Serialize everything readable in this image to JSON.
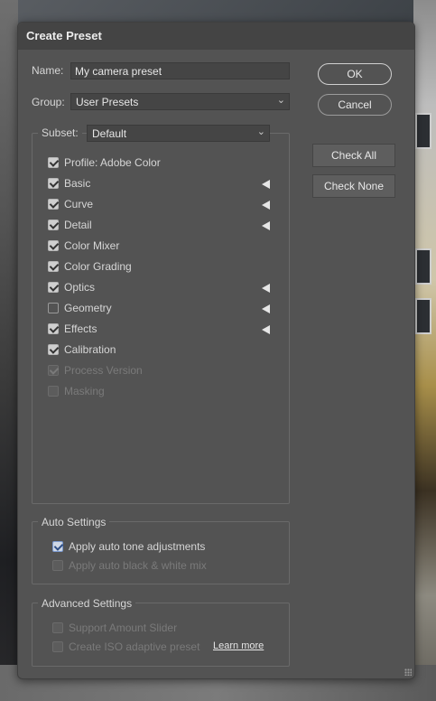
{
  "dialog": {
    "title": "Create Preset"
  },
  "name": {
    "label": "Name:",
    "value": "My camera preset"
  },
  "group": {
    "label": "Group:",
    "value": "User Presets"
  },
  "buttons": {
    "ok": "OK",
    "cancel": "Cancel",
    "check_all": "Check All",
    "check_none": "Check None"
  },
  "subset": {
    "label": "Subset:",
    "value": "Default"
  },
  "settings": [
    {
      "label": "Profile: Adobe Color",
      "checked": true,
      "enabled": true,
      "expandable": false
    },
    {
      "label": "Basic",
      "checked": true,
      "enabled": true,
      "expandable": true
    },
    {
      "label": "Curve",
      "checked": true,
      "enabled": true,
      "expandable": true
    },
    {
      "label": "Detail",
      "checked": true,
      "enabled": true,
      "expandable": true
    },
    {
      "label": "Color Mixer",
      "checked": true,
      "enabled": true,
      "expandable": false
    },
    {
      "label": "Color Grading",
      "checked": true,
      "enabled": true,
      "expandable": false
    },
    {
      "label": "Optics",
      "checked": true,
      "enabled": true,
      "expandable": true
    },
    {
      "label": "Geometry",
      "checked": false,
      "enabled": true,
      "expandable": true
    },
    {
      "label": "Effects",
      "checked": true,
      "enabled": true,
      "expandable": true
    },
    {
      "label": "Calibration",
      "checked": true,
      "enabled": true,
      "expandable": false
    },
    {
      "label": "Process Version",
      "checked": true,
      "enabled": false,
      "expandable": false
    },
    {
      "label": "Masking",
      "checked": false,
      "enabled": false,
      "expandable": false
    }
  ],
  "auto_settings": {
    "title": "Auto Settings",
    "items": [
      {
        "label": "Apply auto tone adjustments",
        "checked": true,
        "enabled": true
      },
      {
        "label": "Apply auto black & white mix",
        "checked": false,
        "enabled": false
      }
    ]
  },
  "advanced_settings": {
    "title": "Advanced Settings",
    "items": [
      {
        "label": "Support Amount Slider",
        "checked": false,
        "enabled": false
      },
      {
        "label": "Create ISO adaptive preset",
        "checked": false,
        "enabled": false
      }
    ],
    "learn_more": "Learn more"
  }
}
